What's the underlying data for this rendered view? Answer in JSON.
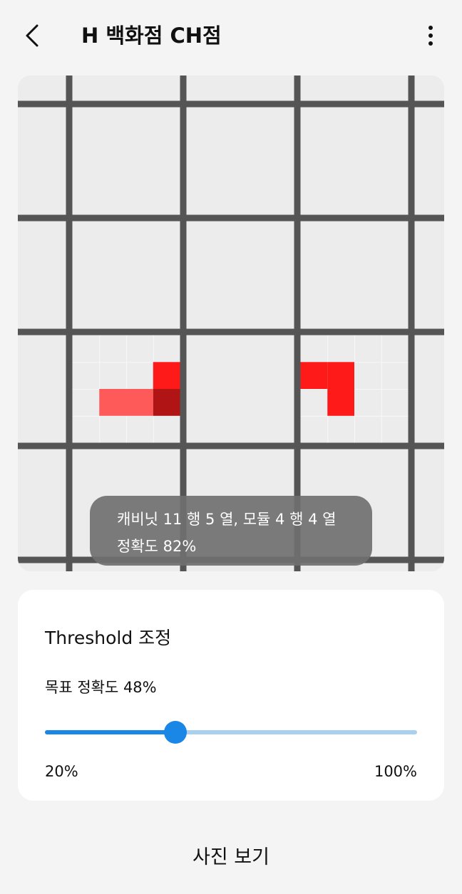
{
  "header": {
    "title": "H 백화점 CH점",
    "back_icon": "chevron-left-icon",
    "menu_icon": "more-vertical-icon"
  },
  "grid_view": {
    "background_color": "#ececec",
    "grid_line_color": "#555555",
    "cabinet_columns": 4,
    "cabinet_rows": 5,
    "modules_per_cabinet": 4,
    "highlighted_cells": [
      {
        "cabinet_col": 0,
        "cabinet_row": 3,
        "module_col": 1,
        "module_row": 2,
        "color": "#ff5a5a"
      },
      {
        "cabinet_col": 0,
        "cabinet_row": 3,
        "module_col": 2,
        "module_row": 2,
        "color": "#ff5a5a"
      },
      {
        "cabinet_col": 0,
        "cabinet_row": 3,
        "module_col": 3,
        "module_row": 1,
        "color": "#ff1a1a"
      },
      {
        "cabinet_col": 0,
        "cabinet_row": 3,
        "module_col": 3,
        "module_row": 2,
        "color": "#b01414"
      },
      {
        "cabinet_col": 2,
        "cabinet_row": 3,
        "module_col": 0,
        "module_row": 1,
        "color": "#ff1a1a"
      },
      {
        "cabinet_col": 2,
        "cabinet_row": 3,
        "module_col": 1,
        "module_row": 1,
        "color": "#ff1a1a"
      },
      {
        "cabinet_col": 2,
        "cabinet_row": 3,
        "module_col": 1,
        "module_row": 2,
        "color": "#ff1a1a"
      }
    ],
    "toast": {
      "line1": "캐비닛 11 행 5 열, 모듈 4 행 4 열",
      "line2": "정확도 82%"
    }
  },
  "threshold": {
    "title": "Threshold 조정",
    "target_label": "목표 정확도 48%",
    "slider": {
      "min": 20,
      "max": 100,
      "value": 48,
      "min_label": "20%",
      "max_label": "100%",
      "active_color": "#1a86e6",
      "inactive_color": "#a9d0ef"
    }
  },
  "footer": {
    "photo_button_label": "사진 보기"
  }
}
